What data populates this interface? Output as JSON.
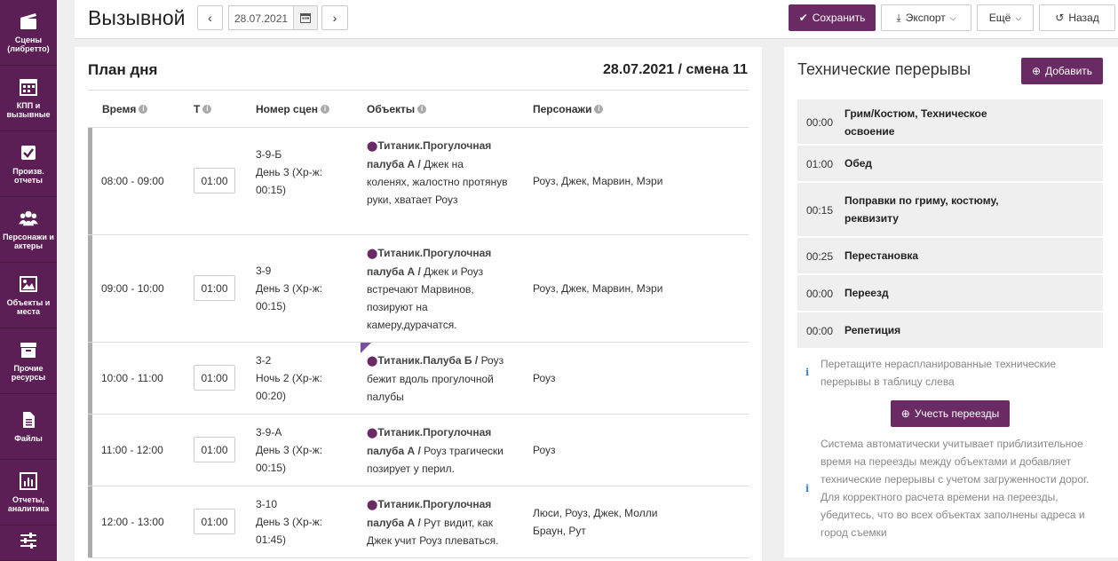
{
  "sidebar": {
    "items": [
      {
        "label": "Сцены (либретто)",
        "icon": "clapperboard-icon"
      },
      {
        "label": "КПП и вызывные",
        "icon": "calendar-icon"
      },
      {
        "label": "Произв. отчеты",
        "icon": "checkbox-icon"
      },
      {
        "label": "Персонажи и актеры",
        "icon": "users-icon"
      },
      {
        "label": "Объекты и места",
        "icon": "image-icon"
      },
      {
        "label": "Прочие ресурсы",
        "icon": "archive-icon"
      },
      {
        "label": "Файлы",
        "icon": "file-icon"
      },
      {
        "label": "Отчеты, аналитика",
        "icon": "bar-chart-icon"
      },
      {
        "label": "",
        "icon": "sliders-icon"
      }
    ]
  },
  "header": {
    "title": "Вызывной",
    "prev": "‹",
    "next": "›",
    "date": "28.07.2021",
    "save": "Сохранить",
    "export": "Экспорт",
    "more": "Ещё",
    "back": "Назад"
  },
  "plan": {
    "title": "План дня",
    "date_shift": "28.07.2021 / смена 11",
    "columns": {
      "time": "Время",
      "t": "Т",
      "scene": "Номер сцен",
      "objects": "Объекты",
      "characters": "Персонажи"
    },
    "rows": [
      {
        "time": "08:00 - 09:00",
        "t": "01:00",
        "scene_no": "3-9-Б",
        "scene_day": "День 3 (Хр-ж:",
        "scene_dur": "00:15)",
        "object": "Титаник.Прогулочная палуба А /",
        "desc": "Джек на коленях, жалостно протянув руки, хватает Роуз",
        "characters": "Роуз, Джек, Марвин, Мэри"
      },
      {
        "time": "09:00 - 10:00",
        "t": "01:00",
        "scene_no": "3-9",
        "scene_day": "День 3 (Хр-ж:",
        "scene_dur": "00:15)",
        "object": "Титаник.Прогулочная палуба А /",
        "desc": "Джек и Роуз встречают Марвинов, позируют на камеру,дурачатся.",
        "characters": "Роуз, Джек, Марвин, Мэри"
      },
      {
        "time": "10:00 - 11:00",
        "t": "01:00",
        "scene_no": "3-2",
        "scene_day": "Ночь 2 (Хр-ж:",
        "scene_dur": "00:20)",
        "object": "Титаник.Палуба Б /",
        "desc": "Роуз бежит вдоль прогулочной палубы",
        "characters": "Роуз"
      },
      {
        "time": "11:00 - 12:00",
        "t": "01:00",
        "scene_no": "3-9-А",
        "scene_day": "День 3 (Хр-ж:",
        "scene_dur": "00:15)",
        "object": "Титаник.Прогулочная палуба А /",
        "desc": "Роуз трагически позирует у перил.",
        "characters": "Роуз"
      },
      {
        "time": "12:00 - 13:00",
        "t": "01:00",
        "scene_no": "3-10",
        "scene_day": "День 3 (Хр-ж:",
        "scene_dur": "01:45)",
        "object": "Титаник.Прогулочная палуба А /",
        "desc": "Рут видит, как Джек учит Роуз плеваться.",
        "characters": "Люси, Роуз, Джек, Молли Браун, Рут"
      }
    ]
  },
  "breaks": {
    "title": "Технические перерывы",
    "add": "Добавить",
    "items": [
      {
        "time": "00:00",
        "name": "Грим/Костюм, Техническое освоение"
      },
      {
        "time": "01:00",
        "name": "Обед"
      },
      {
        "time": "00:15",
        "name": "Поправки по гриму, костюму, реквизиту"
      },
      {
        "time": "00:25",
        "name": "Перестановка"
      },
      {
        "time": "00:00",
        "name": "Переезд"
      },
      {
        "time": "00:00",
        "name": "Репетиция"
      }
    ],
    "drag_hint": "Перетащите нераспланированные технические перерывы в таблицу слева",
    "moves_button": "Учесть переезды",
    "moves_hint": "Система автоматически учитывает приблизительное время на переезды между объектами и добавляет технические перерывы с учетом загруженности дорог. Для корректного расчета времени на переезды, убедитесь, что во всех объектах заполнены адреса и город съемки"
  },
  "colors": {
    "brand": "#5b1f55",
    "accent": "#6a2a63",
    "row_bar": "#ababab"
  }
}
